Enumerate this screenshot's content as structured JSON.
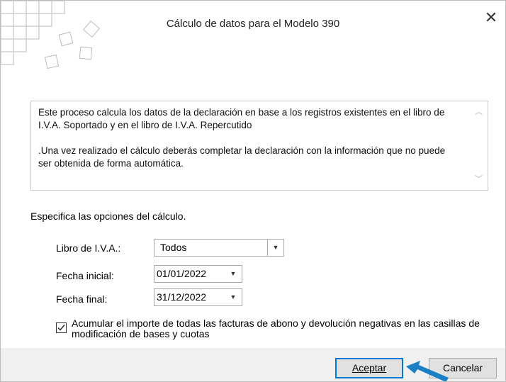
{
  "dialog": {
    "title": "Cálculo de datos para el Modelo 390",
    "close_symbol": "✕"
  },
  "description": {
    "paragraph1": "Este proceso calcula los datos de la declaración en base a los registros existentes en el libro de I.V.A. Soportado y en el libro de I.V.A. Repercutido",
    "paragraph2": ".Una vez realizado el cálculo deberás completar la declaración con la información que no puede ser obtenida de forma automática."
  },
  "options": {
    "heading": "Especifica las opciones del cálculo.",
    "libro_label": "Libro de I.V.A.:",
    "libro_value": "Todos",
    "fecha_inicial_label": "Fecha inicial:",
    "fecha_inicial_value": "01/01/2022",
    "fecha_final_label": "Fecha final:",
    "fecha_final_value": "31/12/2022",
    "checkbox_label": "Acumular el importe de todas las facturas de abono y devolución negativas en las casillas de modificación de bases y cuotas",
    "checkbox_checked": true
  },
  "buttons": {
    "accept": "Aceptar",
    "cancel": "Cancelar"
  },
  "colors": {
    "accent": "#0078d7",
    "pointer": "#1a7fc4"
  },
  "icons": [
    "app-logo-icon",
    "close-icon",
    "scroll-up-icon",
    "scroll-down-icon",
    "dropdown-arrow-icon",
    "checkmark-icon",
    "mouse-pointer-icon"
  ]
}
